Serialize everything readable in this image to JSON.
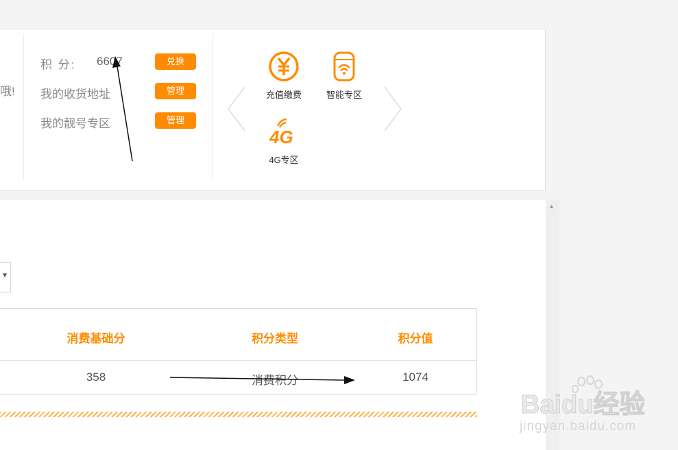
{
  "account": {
    "cut_text": "哦!",
    "points_label": "积  分:",
    "points_value": "6607",
    "redeem_button": "兑换",
    "address_label": "我的收货地址",
    "address_button": "管理",
    "numbers_label": "我的靓号专区",
    "numbers_button": "管理"
  },
  "services": [
    {
      "label": "充值缴费",
      "icon": "yuan-circle-icon"
    },
    {
      "label": "智能专区",
      "icon": "smart-device-icon"
    },
    {
      "label": "4G专区",
      "icon": "4g-signal-icon"
    }
  ],
  "table": {
    "headers": [
      "消费基础分",
      "积分类型",
      "积分值"
    ],
    "row": [
      "358",
      "消费积分",
      "1074"
    ]
  },
  "watermark": {
    "brand": "Baidu经验",
    "url": "jingyan.baidu.com"
  },
  "colors": {
    "accent": "#ff8c00",
    "text_gray": "#8a8a8a"
  }
}
